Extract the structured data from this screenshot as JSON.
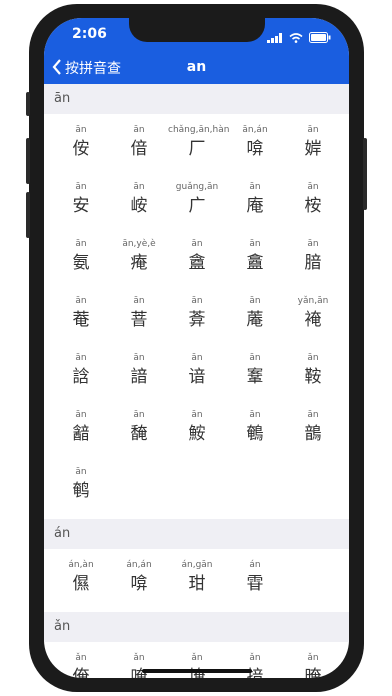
{
  "status_bar": {
    "time": "2:06"
  },
  "nav": {
    "back_label": "按拼音查",
    "title": "an"
  },
  "sections": [
    {
      "header": "ān",
      "items": [
        {
          "pinyin": "ān",
          "char": "侒"
        },
        {
          "pinyin": "ān",
          "char": "偣"
        },
        {
          "pinyin": "chǎng,ān,hàn",
          "char": "厂"
        },
        {
          "pinyin": "ān,án",
          "char": "啽"
        },
        {
          "pinyin": "ān",
          "char": "婩"
        },
        {
          "pinyin": "ān",
          "char": "安"
        },
        {
          "pinyin": "ān",
          "char": "峖"
        },
        {
          "pinyin": "guǎng,ān",
          "char": "广"
        },
        {
          "pinyin": "ān",
          "char": "庵"
        },
        {
          "pinyin": "ān",
          "char": "桉"
        },
        {
          "pinyin": "ān",
          "char": "氨"
        },
        {
          "pinyin": "ān,yè,è",
          "char": "痷"
        },
        {
          "pinyin": "ān",
          "char": "盦"
        },
        {
          "pinyin": "ān",
          "char": "盫"
        },
        {
          "pinyin": "ān",
          "char": "腤"
        },
        {
          "pinyin": "ān",
          "char": "菴"
        },
        {
          "pinyin": "ān",
          "char": "萻"
        },
        {
          "pinyin": "ān",
          "char": "葊"
        },
        {
          "pinyin": "ān",
          "char": "蓭"
        },
        {
          "pinyin": "yǎn,ān",
          "char": "裺"
        },
        {
          "pinyin": "ān",
          "char": "誝"
        },
        {
          "pinyin": "ān",
          "char": "諳"
        },
        {
          "pinyin": "ān",
          "char": "谙"
        },
        {
          "pinyin": "ān",
          "char": "鞌"
        },
        {
          "pinyin": "ān",
          "char": "鞍"
        },
        {
          "pinyin": "ān",
          "char": "韽"
        },
        {
          "pinyin": "ān",
          "char": "馣"
        },
        {
          "pinyin": "ān",
          "char": "鮟"
        },
        {
          "pinyin": "ān",
          "char": "鵪"
        },
        {
          "pinyin": "ān",
          "char": "鶕"
        },
        {
          "pinyin": "ān",
          "char": "鹌"
        }
      ]
    },
    {
      "header": "án",
      "items": [
        {
          "pinyin": "án,àn",
          "char": "儑"
        },
        {
          "pinyin": "án,án",
          "char": "啽"
        },
        {
          "pinyin": "án,gān",
          "char": "玵"
        },
        {
          "pinyin": "án",
          "char": "雸"
        }
      ]
    },
    {
      "header": "ǎn",
      "items": [
        {
          "pinyin": "ǎn",
          "char": "俺"
        },
        {
          "pinyin": "ǎn",
          "char": "唵"
        },
        {
          "pinyin": "ǎn",
          "char": "埯"
        },
        {
          "pinyin": "ǎn",
          "char": "揞"
        },
        {
          "pinyin": "ǎn",
          "char": "晻"
        }
      ]
    }
  ]
}
